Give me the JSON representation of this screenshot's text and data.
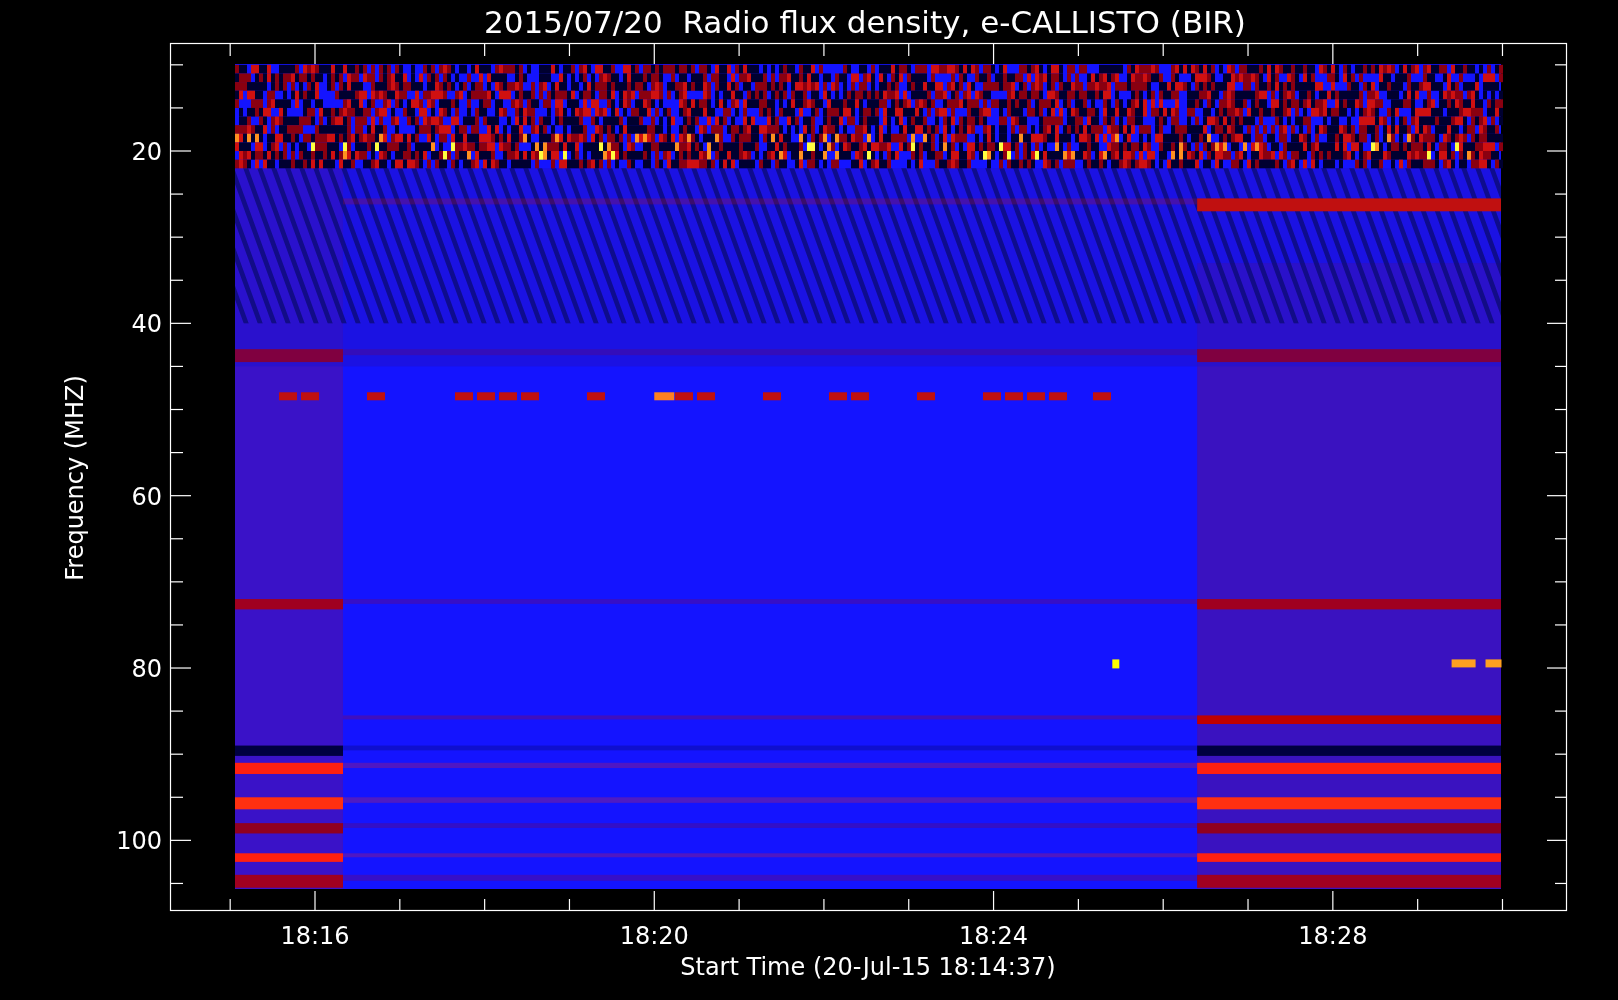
{
  "title": "2015/07/20  Radio flux density, e-CALLISTO (BIR)",
  "y_axis": {
    "label": "Frequency (MHZ)",
    "ticks": [
      "20",
      "40",
      "60",
      "80",
      "100"
    ]
  },
  "x_axis": {
    "label": "Start Time (20-Jul-15 18:14:37)",
    "ticks": [
      "18:16",
      "18:20",
      "18:24",
      "18:28"
    ]
  }
}
